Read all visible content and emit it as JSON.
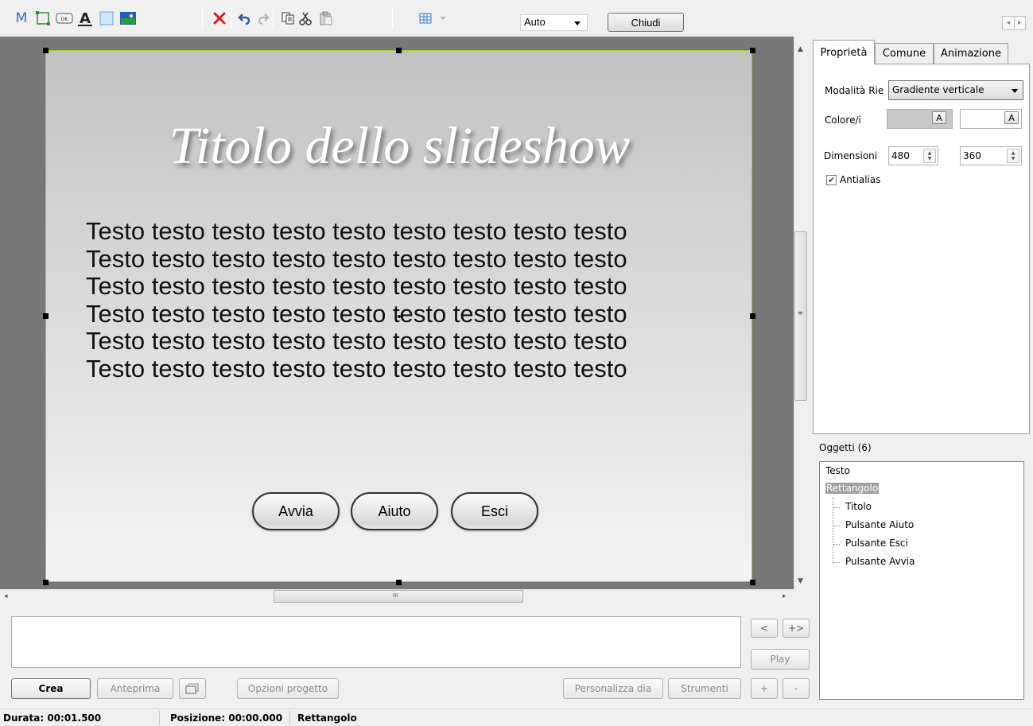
{
  "toolbar": {
    "zoom_value": "Auto",
    "close_label": "Chiudi"
  },
  "slide": {
    "title": "Titolo dello slideshow",
    "body_lines": [
      "Testo testo testo testo testo testo testo testo testo",
      "Testo testo testo testo testo testo testo testo testo",
      "Testo testo testo testo testo testo testo testo testo",
      "Testo testo testo testo testo testo testo testo testo",
      "Testo testo testo testo testo testo testo testo testo",
      "Testo testo testo testo testo testo testo testo testo"
    ],
    "buttons": [
      "Avvia",
      "Aiuto",
      "Esci"
    ]
  },
  "hscroll_grip": "III",
  "bottom": {
    "prev": "<",
    "add": "+>",
    "play": "Play",
    "crea": "Crea",
    "anteprima": "Anteprima",
    "opzioni": "Opzioni progetto",
    "personalizza": "Personalizza dia",
    "strumenti": "Strumenti",
    "plus": "+",
    "minus": "-"
  },
  "tabs": [
    "Proprietà",
    "Comune",
    "Animazione"
  ],
  "properties": {
    "fill_mode_label": "Modalità Rie",
    "fill_mode_value": "Gradiente verticale",
    "colors_label": "Colore/i",
    "color_btn": "A",
    "color1": "#c8c8c8",
    "color2": "#ffffff",
    "dimensions_label": "Dimensioni",
    "width": "480",
    "height": "360",
    "antialias_label": "Antialias",
    "antialias_checked": true
  },
  "objects": {
    "header": "Oggetti (6)",
    "items": [
      "Testo",
      "Rettangolo",
      "Titolo",
      "Pulsante Aiuto",
      "Pulsante Esci",
      "Pulsante Avvia"
    ]
  },
  "status": {
    "duration": "Durata: 00:01.500",
    "position": "Posizione: 00:00.000",
    "selection": "Rettangolo"
  },
  "colors": {
    "selection_border": "#9acd32",
    "canvas_bg": "#777777"
  }
}
